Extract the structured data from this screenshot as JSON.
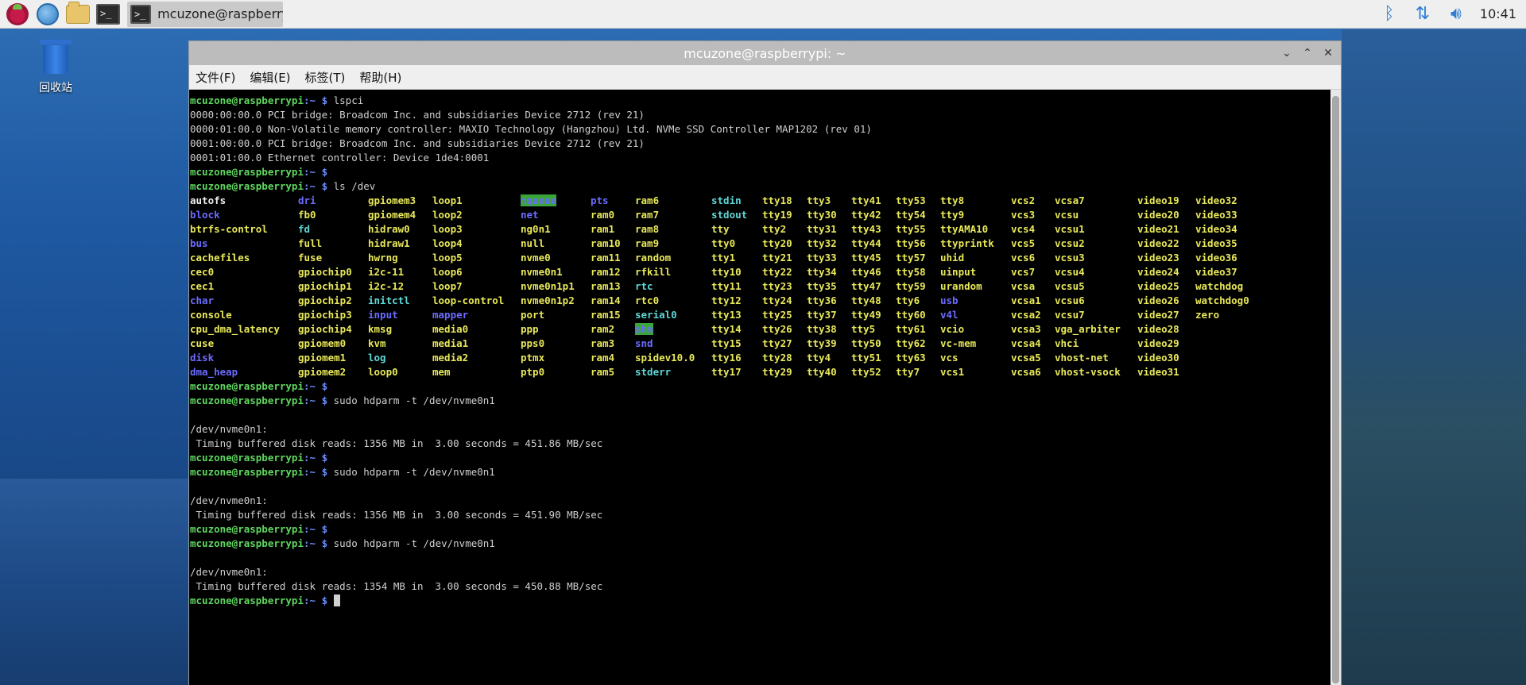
{
  "taskbar": {
    "task_title": "mcuzone@raspberry..",
    "clock": "10:41"
  },
  "desktop": {
    "trash_label": "回收站"
  },
  "window": {
    "title": "mcuzone@raspberrypi: ~",
    "menu": [
      "文件(F)",
      "编辑(E)",
      "标签(T)",
      "帮助(H)"
    ]
  },
  "terminal": {
    "prompt_user": "mcuzone@raspberrypi",
    "prompt_path": ":~ $",
    "lines": [
      {
        "type": "cmd",
        "text": " lspci"
      },
      {
        "type": "out",
        "text": "0000:00:00.0 PCI bridge: Broadcom Inc. and subsidiaries Device 2712 (rev 21)"
      },
      {
        "type": "out",
        "text": "0000:01:00.0 Non-Volatile memory controller: MAXIO Technology (Hangzhou) Ltd. NVMe SSD Controller MAP1202 (rev 01)"
      },
      {
        "type": "out",
        "text": "0001:00:00.0 PCI bridge: Broadcom Inc. and subsidiaries Device 2712 (rev 21)"
      },
      {
        "type": "out",
        "text": "0001:01:00.0 Ethernet controller: Device 1de4:0001"
      },
      {
        "type": "cmd",
        "text": ""
      },
      {
        "type": "cmd",
        "text": " ls /dev"
      }
    ],
    "ls_rows": [
      [
        [
          "autofs",
          "f"
        ],
        [
          "dri",
          "d"
        ],
        [
          "gpiomem3",
          "v"
        ],
        [
          "loop1",
          "v"
        ],
        [
          "mqueue",
          "h"
        ],
        [
          "pts",
          "d"
        ],
        [
          "ram6",
          "v"
        ],
        [
          "stdin",
          "l"
        ],
        [
          "tty18",
          "v"
        ],
        [
          "tty3",
          "v"
        ],
        [
          "tty41",
          "v"
        ],
        [
          "tty53",
          "v"
        ],
        [
          "tty8",
          "v"
        ],
        [
          "vcs2",
          "v"
        ],
        [
          "vcsa7",
          "v"
        ],
        [
          "video19",
          "v"
        ],
        [
          "video32",
          "v"
        ]
      ],
      [
        [
          "block",
          "d"
        ],
        [
          "fb0",
          "v"
        ],
        [
          "gpiomem4",
          "v"
        ],
        [
          "loop2",
          "v"
        ],
        [
          "net",
          "d"
        ],
        [
          "ram0",
          "v"
        ],
        [
          "ram7",
          "v"
        ],
        [
          "stdout",
          "l"
        ],
        [
          "tty19",
          "v"
        ],
        [
          "tty30",
          "v"
        ],
        [
          "tty42",
          "v"
        ],
        [
          "tty54",
          "v"
        ],
        [
          "tty9",
          "v"
        ],
        [
          "vcs3",
          "v"
        ],
        [
          "vcsu",
          "v"
        ],
        [
          "video20",
          "v"
        ],
        [
          "video33",
          "v"
        ]
      ],
      [
        [
          "btrfs-control",
          "v"
        ],
        [
          "fd",
          "l"
        ],
        [
          "hidraw0",
          "v"
        ],
        [
          "loop3",
          "v"
        ],
        [
          "ng0n1",
          "v"
        ],
        [
          "ram1",
          "v"
        ],
        [
          "ram8",
          "v"
        ],
        [
          "tty",
          "v"
        ],
        [
          "tty2",
          "v"
        ],
        [
          "tty31",
          "v"
        ],
        [
          "tty43",
          "v"
        ],
        [
          "tty55",
          "v"
        ],
        [
          "ttyAMA10",
          "v"
        ],
        [
          "vcs4",
          "v"
        ],
        [
          "vcsu1",
          "v"
        ],
        [
          "video21",
          "v"
        ],
        [
          "video34",
          "v"
        ]
      ],
      [
        [
          "bus",
          "d"
        ],
        [
          "full",
          "v"
        ],
        [
          "hidraw1",
          "v"
        ],
        [
          "loop4",
          "v"
        ],
        [
          "null",
          "v"
        ],
        [
          "ram10",
          "v"
        ],
        [
          "ram9",
          "v"
        ],
        [
          "tty0",
          "v"
        ],
        [
          "tty20",
          "v"
        ],
        [
          "tty32",
          "v"
        ],
        [
          "tty44",
          "v"
        ],
        [
          "tty56",
          "v"
        ],
        [
          "ttyprintk",
          "v"
        ],
        [
          "vcs5",
          "v"
        ],
        [
          "vcsu2",
          "v"
        ],
        [
          "video22",
          "v"
        ],
        [
          "video35",
          "v"
        ]
      ],
      [
        [
          "cachefiles",
          "v"
        ],
        [
          "fuse",
          "v"
        ],
        [
          "hwrng",
          "v"
        ],
        [
          "loop5",
          "v"
        ],
        [
          "nvme0",
          "v"
        ],
        [
          "ram11",
          "v"
        ],
        [
          "random",
          "v"
        ],
        [
          "tty1",
          "v"
        ],
        [
          "tty21",
          "v"
        ],
        [
          "tty33",
          "v"
        ],
        [
          "tty45",
          "v"
        ],
        [
          "tty57",
          "v"
        ],
        [
          "uhid",
          "v"
        ],
        [
          "vcs6",
          "v"
        ],
        [
          "vcsu3",
          "v"
        ],
        [
          "video23",
          "v"
        ],
        [
          "video36",
          "v"
        ]
      ],
      [
        [
          "cec0",
          "v"
        ],
        [
          "gpiochip0",
          "v"
        ],
        [
          "i2c-11",
          "v"
        ],
        [
          "loop6",
          "v"
        ],
        [
          "nvme0n1",
          "v"
        ],
        [
          "ram12",
          "v"
        ],
        [
          "rfkill",
          "v"
        ],
        [
          "tty10",
          "v"
        ],
        [
          "tty22",
          "v"
        ],
        [
          "tty34",
          "v"
        ],
        [
          "tty46",
          "v"
        ],
        [
          "tty58",
          "v"
        ],
        [
          "uinput",
          "v"
        ],
        [
          "vcs7",
          "v"
        ],
        [
          "vcsu4",
          "v"
        ],
        [
          "video24",
          "v"
        ],
        [
          "video37",
          "v"
        ]
      ],
      [
        [
          "cec1",
          "v"
        ],
        [
          "gpiochip1",
          "v"
        ],
        [
          "i2c-12",
          "v"
        ],
        [
          "loop7",
          "v"
        ],
        [
          "nvme0n1p1",
          "v"
        ],
        [
          "ram13",
          "v"
        ],
        [
          "rtc",
          "l"
        ],
        [
          "tty11",
          "v"
        ],
        [
          "tty23",
          "v"
        ],
        [
          "tty35",
          "v"
        ],
        [
          "tty47",
          "v"
        ],
        [
          "tty59",
          "v"
        ],
        [
          "urandom",
          "v"
        ],
        [
          "vcsa",
          "v"
        ],
        [
          "vcsu5",
          "v"
        ],
        [
          "video25",
          "v"
        ],
        [
          "watchdog",
          "v"
        ]
      ],
      [
        [
          "char",
          "d"
        ],
        [
          "gpiochip2",
          "v"
        ],
        [
          "initctl",
          "l"
        ],
        [
          "loop-control",
          "v"
        ],
        [
          "nvme0n1p2",
          "v"
        ],
        [
          "ram14",
          "v"
        ],
        [
          "rtc0",
          "v"
        ],
        [
          "tty12",
          "v"
        ],
        [
          "tty24",
          "v"
        ],
        [
          "tty36",
          "v"
        ],
        [
          "tty48",
          "v"
        ],
        [
          "tty6",
          "v"
        ],
        [
          "usb",
          "d"
        ],
        [
          "vcsa1",
          "v"
        ],
        [
          "vcsu6",
          "v"
        ],
        [
          "video26",
          "v"
        ],
        [
          "watchdog0",
          "v"
        ]
      ],
      [
        [
          "console",
          "v"
        ],
        [
          "gpiochip3",
          "v"
        ],
        [
          "input",
          "d"
        ],
        [
          "mapper",
          "d"
        ],
        [
          "port",
          "v"
        ],
        [
          "ram15",
          "v"
        ],
        [
          "serial0",
          "l"
        ],
        [
          "tty13",
          "v"
        ],
        [
          "tty25",
          "v"
        ],
        [
          "tty37",
          "v"
        ],
        [
          "tty49",
          "v"
        ],
        [
          "tty60",
          "v"
        ],
        [
          "v4l",
          "d"
        ],
        [
          "vcsa2",
          "v"
        ],
        [
          "vcsu7",
          "v"
        ],
        [
          "video27",
          "v"
        ],
        [
          "zero",
          "v"
        ]
      ],
      [
        [
          "cpu_dma_latency",
          "v"
        ],
        [
          "gpiochip4",
          "v"
        ],
        [
          "kmsg",
          "v"
        ],
        [
          "media0",
          "v"
        ],
        [
          "ppp",
          "v"
        ],
        [
          "ram2",
          "v"
        ],
        [
          "shm",
          "h"
        ],
        [
          "tty14",
          "v"
        ],
        [
          "tty26",
          "v"
        ],
        [
          "tty38",
          "v"
        ],
        [
          "tty5",
          "v"
        ],
        [
          "tty61",
          "v"
        ],
        [
          "vcio",
          "v"
        ],
        [
          "vcsa3",
          "v"
        ],
        [
          "vga_arbiter",
          "v"
        ],
        [
          "video28",
          "v"
        ],
        [
          "",
          ""
        ]
      ],
      [
        [
          "cuse",
          "v"
        ],
        [
          "gpiomem0",
          "v"
        ],
        [
          "kvm",
          "v"
        ],
        [
          "media1",
          "v"
        ],
        [
          "pps0",
          "v"
        ],
        [
          "ram3",
          "v"
        ],
        [
          "snd",
          "d"
        ],
        [
          "tty15",
          "v"
        ],
        [
          "tty27",
          "v"
        ],
        [
          "tty39",
          "v"
        ],
        [
          "tty50",
          "v"
        ],
        [
          "tty62",
          "v"
        ],
        [
          "vc-mem",
          "v"
        ],
        [
          "vcsa4",
          "v"
        ],
        [
          "vhci",
          "v"
        ],
        [
          "video29",
          "v"
        ],
        [
          "",
          ""
        ]
      ],
      [
        [
          "disk",
          "d"
        ],
        [
          "gpiomem1",
          "v"
        ],
        [
          "log",
          "l"
        ],
        [
          "media2",
          "v"
        ],
        [
          "ptmx",
          "v"
        ],
        [
          "ram4",
          "v"
        ],
        [
          "spidev10.0",
          "v"
        ],
        [
          "tty16",
          "v"
        ],
        [
          "tty28",
          "v"
        ],
        [
          "tty4",
          "v"
        ],
        [
          "tty51",
          "v"
        ],
        [
          "tty63",
          "v"
        ],
        [
          "vcs",
          "v"
        ],
        [
          "vcsa5",
          "v"
        ],
        [
          "vhost-net",
          "v"
        ],
        [
          "video30",
          "v"
        ],
        [
          "",
          ""
        ]
      ],
      [
        [
          "dma_heap",
          "d"
        ],
        [
          "gpiomem2",
          "v"
        ],
        [
          "loop0",
          "v"
        ],
        [
          "mem",
          "v"
        ],
        [
          "ptp0",
          "v"
        ],
        [
          "ram5",
          "v"
        ],
        [
          "stderr",
          "l"
        ],
        [
          "tty17",
          "v"
        ],
        [
          "tty29",
          "v"
        ],
        [
          "tty40",
          "v"
        ],
        [
          "tty52",
          "v"
        ],
        [
          "tty7",
          "v"
        ],
        [
          "vcs1",
          "v"
        ],
        [
          "vcsa6",
          "v"
        ],
        [
          "vhost-vsock",
          "v"
        ],
        [
          "video31",
          "v"
        ],
        [
          "",
          ""
        ]
      ]
    ],
    "lines_after": [
      {
        "type": "cmd",
        "text": ""
      },
      {
        "type": "cmd",
        "text": " sudo hdparm -t /dev/nvme0n1"
      },
      {
        "type": "out",
        "text": ""
      },
      {
        "type": "out",
        "text": "/dev/nvme0n1:"
      },
      {
        "type": "out",
        "text": " Timing buffered disk reads: 1356 MB in  3.00 seconds = 451.86 MB/sec"
      },
      {
        "type": "cmd",
        "text": ""
      },
      {
        "type": "cmd",
        "text": " sudo hdparm -t /dev/nvme0n1"
      },
      {
        "type": "out",
        "text": ""
      },
      {
        "type": "out",
        "text": "/dev/nvme0n1:"
      },
      {
        "type": "out",
        "text": " Timing buffered disk reads: 1356 MB in  3.00 seconds = 451.90 MB/sec"
      },
      {
        "type": "cmd",
        "text": ""
      },
      {
        "type": "cmd",
        "text": " sudo hdparm -t /dev/nvme0n1"
      },
      {
        "type": "out",
        "text": ""
      },
      {
        "type": "out",
        "text": "/dev/nvme0n1:"
      },
      {
        "type": "out",
        "text": " Timing buffered disk reads: 1354 MB in  3.00 seconds = 450.88 MB/sec"
      },
      {
        "type": "prompt_cursor",
        "text": " "
      }
    ]
  }
}
